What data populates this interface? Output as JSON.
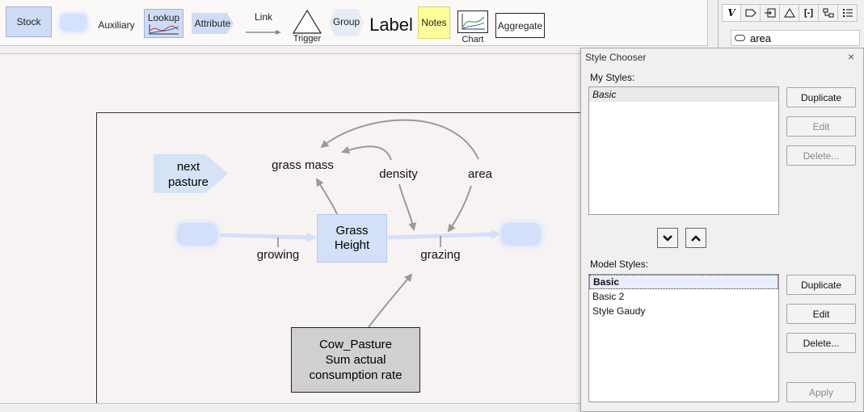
{
  "toolbar": {
    "stock": "Stock",
    "auxiliary": "Auxiliary",
    "lookup": "Lookup",
    "attribute": "Attribute",
    "link": "Link",
    "trigger": "Trigger",
    "group": "Group",
    "label": "Label",
    "notes": "Notes",
    "chart": "Chart",
    "aggregate": "Aggregate"
  },
  "right_panel": {
    "tabs": [
      "𝑉",
      "",
      "",
      "",
      "",
      "",
      ""
    ],
    "search_value": "area"
  },
  "diagram": {
    "next_pasture": [
      "next",
      "pasture"
    ],
    "grass_mass": "grass mass",
    "density": "density",
    "area": "area",
    "stock": [
      "Grass",
      "Height"
    ],
    "growing": "growing",
    "grazing": "grazing",
    "cow_pasture": [
      "Cow_Pasture",
      "Sum actual",
      "consumption rate"
    ]
  },
  "dialog": {
    "title": "Style Chooser",
    "close": "×",
    "my_styles_label": "My Styles:",
    "my_styles": [
      "Basic"
    ],
    "my_buttons": [
      "Duplicate",
      "Edit",
      "Delete..."
    ],
    "model_styles_label": "Model Styles:",
    "model_styles": [
      "Basic",
      "Basic 2",
      "Style Gaudy"
    ],
    "model_buttons": [
      "Duplicate",
      "Edit",
      "Delete..."
    ],
    "apply": "Apply"
  }
}
